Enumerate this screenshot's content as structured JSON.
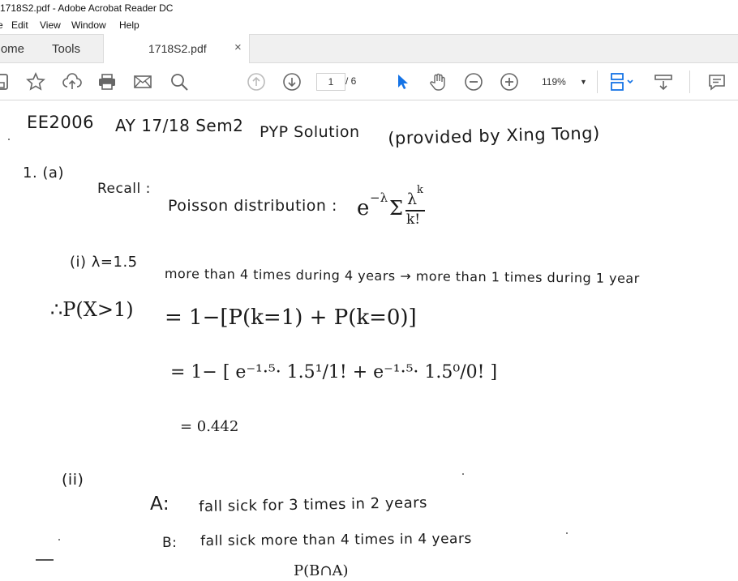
{
  "window": {
    "title": "1718S2.pdf - Adobe Acrobat Reader DC"
  },
  "menu": {
    "items": [
      "Edit",
      "View",
      "Window",
      "Help"
    ]
  },
  "tabs": {
    "home": "Home",
    "tools": "Tools",
    "document": "1718S2.pdf",
    "close_glyph": "×"
  },
  "toolbar": {
    "page_current": "1",
    "page_total": "/ 6",
    "zoom": "119%",
    "icons": [
      "save-icon",
      "star-icon",
      "upload-icon",
      "print-icon",
      "mail-icon",
      "search-icon",
      "page-up-icon",
      "page-down-icon",
      "pointer-icon",
      "hand-icon",
      "zoom-out-icon",
      "zoom-in-icon",
      "page-view-icon",
      "scroll-icon",
      "comment-icon"
    ]
  },
  "doc": {
    "header": {
      "course": "EE2006",
      "term": "AY 17/18 Sem2",
      "kind": "PYP Solution",
      "credit": "(provided by Xing Tong)"
    },
    "q1": {
      "label": "1.  (a)",
      "recall": "Recall :",
      "poisson_label": "Poisson distribution  :",
      "poisson_formula": "e",
      "poisson_exp": "−λ",
      "poisson_sigma": "Σ",
      "poisson_num": "λ",
      "poisson_num_exp": "k",
      "poisson_den": "k!",
      "part_i": "(i) λ=1.5",
      "part_i_text": "more than 4 times during 4 years → more than 1 times during 1 year",
      "px_label": "∴P(X>1)",
      "line1": "= 1−[P(k=1) + P(k=0)]",
      "line2": "= 1− [ e⁻¹·⁵· 1.5¹/1! + e⁻¹·⁵· 1.5⁰/0! ]",
      "line3": "= 0.442",
      "part_ii": "(ii)",
      "event_a_label": "A:",
      "event_a": "fall sick for 3 times in 2 years",
      "event_b_label": "B:",
      "event_b": "fall sick more than 4 times   in  4 years",
      "prob": "P(B∩A)"
    }
  }
}
